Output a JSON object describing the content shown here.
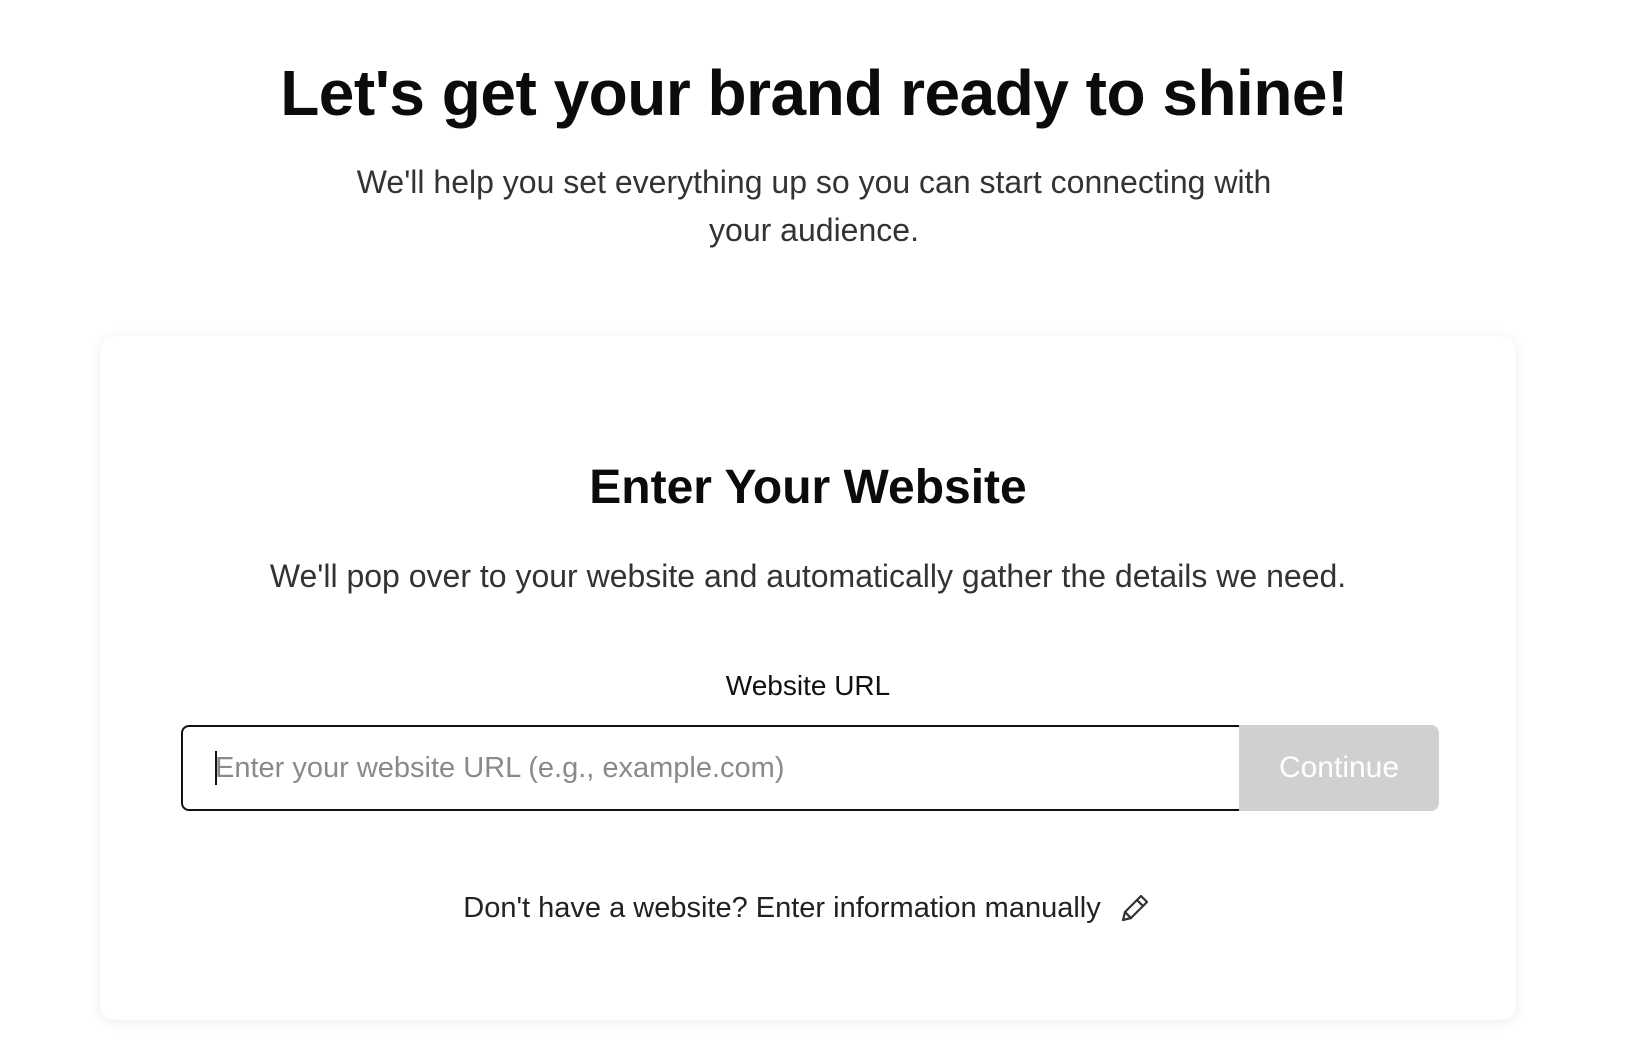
{
  "hero": {
    "title": "Let's get your brand ready to shine!",
    "subtitle": "We'll help you set everything up so you can start connecting with your audience."
  },
  "card": {
    "title": "Enter Your Website",
    "description": "We'll pop over to your website and automatically gather the details we need.",
    "field_label": "Website URL",
    "url_input": {
      "value": "",
      "placeholder": "Enter your website URL (e.g., example.com)"
    },
    "continue_label": "Continue",
    "manual_link_label": "Don't have a website? Enter information manually",
    "manual_link_icon": "pencil-icon"
  },
  "colors": {
    "button_disabled": "#d0d0d0",
    "text_primary": "#0b0b0b",
    "text_secondary": "#333333"
  }
}
